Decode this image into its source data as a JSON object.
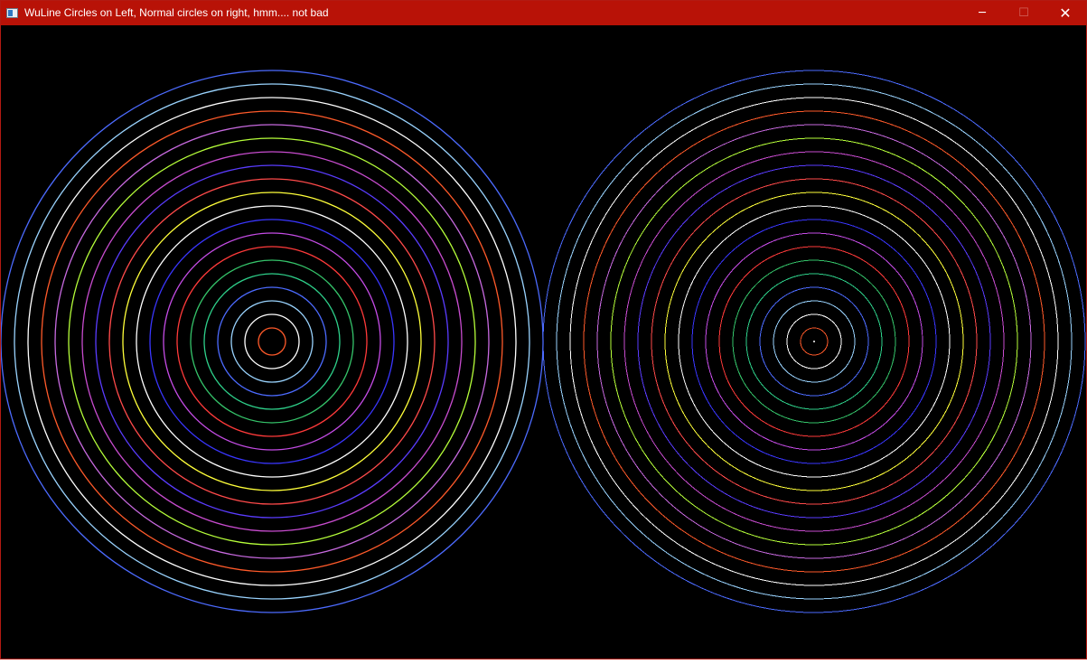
{
  "window": {
    "title": "WuLine Circles on Left, Normal circles on right, hmm.... not bad",
    "icon": "app-window-icon",
    "controls": {
      "minimize_glyph": "─",
      "maximize_glyph": "☐",
      "close_glyph": "✕"
    }
  },
  "canvas": {
    "background": "#000000",
    "ring_colors": [
      "#ff5a2a",
      "#ffffff",
      "#9ad4ff",
      "#4c6bff",
      "#2ed08a",
      "#35c46a",
      "#ff3a3a",
      "#c54ce6",
      "#3a36ff",
      "#ffffff",
      "#ffff3a",
      "#ff4a4a",
      "#5a3cff",
      "#c84ccf",
      "#b6ff3a",
      "#c86ae0"
    ],
    "left_label": "WuLine circles",
    "right_label": "Normal circles"
  }
}
